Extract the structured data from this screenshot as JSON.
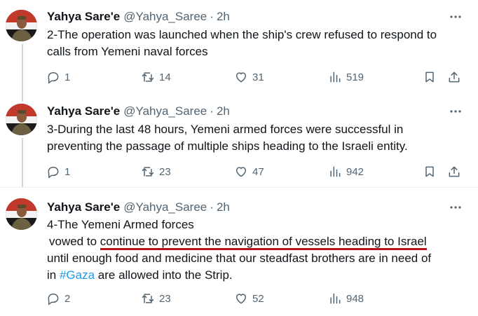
{
  "tweets": [
    {
      "author": {
        "name": "Yahya Sare'e",
        "handle": "@Yahya_Saree"
      },
      "separator": "·",
      "time": "2h",
      "lines": [
        "2-The operation was launched when the ship's crew refused to respond to",
        "calls from Yemeni naval forces"
      ],
      "stats": {
        "replies": "1",
        "reposts": "14",
        "likes": "31",
        "views": "519"
      }
    },
    {
      "author": {
        "name": "Yahya Sare'e",
        "handle": "@Yahya_Saree"
      },
      "separator": "·",
      "time": "2h",
      "lines": [
        "3-During the last 48 hours, Yemeni armed forces were successful in",
        "preventing the passage of multiple ships heading to the Israeli entity."
      ],
      "stats": {
        "replies": "1",
        "reposts": "23",
        "likes": "47",
        "views": "942"
      }
    },
    {
      "author": {
        "name": "Yahya Sare'e",
        "handle": "@Yahya_Saree"
      },
      "separator": "·",
      "time": "2h",
      "text": {
        "line1": "4-The Yemeni Armed forces",
        "line2_pre": "vowed to ",
        "line2_highlight": "continue to prevent the navigation of vessels heading to Israel",
        "line3": "until enough food and medicine that our steadfast brothers are in need of",
        "line4_pre": "in ",
        "line4_hashtag": "#Gaza",
        "line4_post": " are allowed into the Strip."
      },
      "stats": {
        "replies": "2",
        "reposts": "23",
        "likes": "52",
        "views": "948"
      }
    }
  ],
  "icons": [
    "avatar",
    "more-icon",
    "reply-icon",
    "repost-icon",
    "like-icon",
    "views-icon",
    "bookmark-icon",
    "share-icon"
  ],
  "colors": {
    "text": "#0f1419",
    "secondary": "#536471",
    "hashtag": "#1d9bf0",
    "highlight_underline": "#b3131f",
    "thread_line": "#cfd9de"
  }
}
